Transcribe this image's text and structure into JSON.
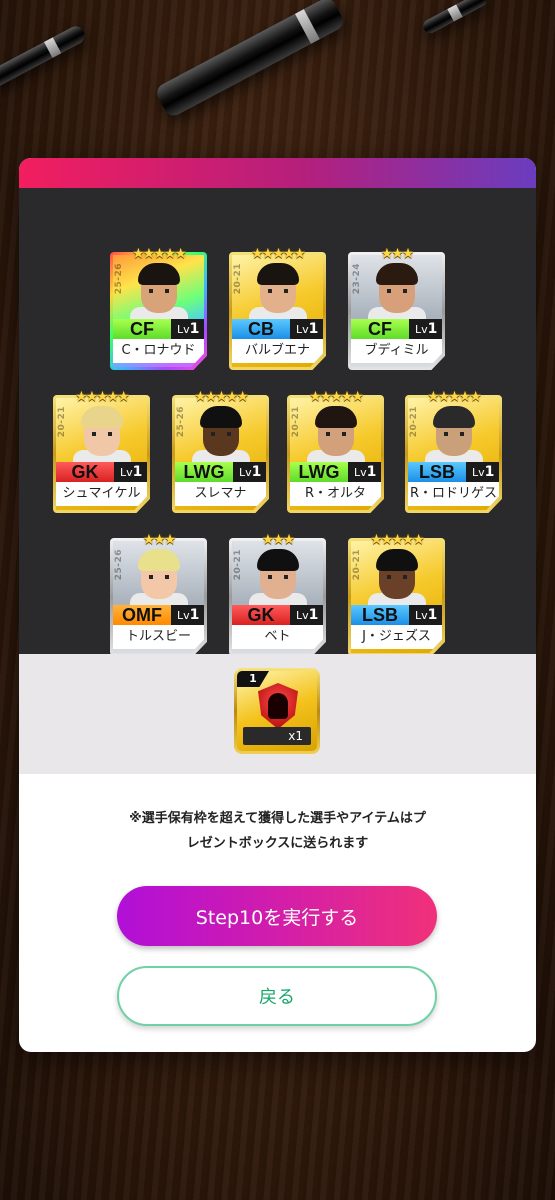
{
  "cards": [
    {
      "stars": "★★★★★",
      "season": "25-26",
      "position": "CF",
      "level_prefix": "Lv",
      "level": "1",
      "name": "C・ロナウド",
      "rarity": "rainbow",
      "pos_group": "fw"
    },
    {
      "stars": "★★★★★",
      "season": "20-21",
      "position": "CB",
      "level_prefix": "Lv",
      "level": "1",
      "name": "バルブエナ",
      "rarity": "gold",
      "pos_group": "df"
    },
    {
      "stars": "★★★",
      "season": "23-24",
      "position": "CF",
      "level_prefix": "Lv",
      "level": "1",
      "name": "ブディミル",
      "rarity": "silver",
      "pos_group": "fw"
    },
    {
      "stars": "★★★★★",
      "season": "20-21",
      "position": "GK",
      "level_prefix": "Lv",
      "level": "1",
      "name": "シュマイケル",
      "rarity": "gold",
      "pos_group": "gk"
    },
    {
      "stars": "★★★★★",
      "season": "25-26",
      "position": "LWG",
      "level_prefix": "Lv",
      "level": "1",
      "name": "スレマナ",
      "rarity": "gold",
      "pos_group": "fw"
    },
    {
      "stars": "★★★★★",
      "season": "20-21",
      "position": "LWG",
      "level_prefix": "Lv",
      "level": "1",
      "name": "R・オルタ",
      "rarity": "gold",
      "pos_group": "fw"
    },
    {
      "stars": "★★★★★",
      "season": "20-21",
      "position": "LSB",
      "level_prefix": "Lv",
      "level": "1",
      "name": "R・ロドリゲス",
      "rarity": "gold",
      "pos_group": "df"
    },
    {
      "stars": "★★★",
      "season": "25-26",
      "position": "OMF",
      "level_prefix": "Lv",
      "level": "1",
      "name": "トルスビー",
      "rarity": "silver",
      "pos_group": "mf"
    },
    {
      "stars": "★★★",
      "season": "20-21",
      "position": "GK",
      "level_prefix": "Lv",
      "level": "1",
      "name": "ベト",
      "rarity": "silver",
      "pos_group": "gk"
    },
    {
      "stars": "★★★★★",
      "season": "20-21",
      "position": "LSB",
      "level_prefix": "Lv",
      "level": "1",
      "name": "J・ジェズス",
      "rarity": "gold",
      "pos_group": "df"
    }
  ],
  "item": {
    "number": "1",
    "count": "x1",
    "icon": "red-shield-player-silhouette-icon"
  },
  "notice": {
    "line1": "※選手保有枠を超えて獲得した選手やアイテムはプ",
    "line2": "レゼントボックスに送られます"
  },
  "buttons": {
    "execute": "Step10を実行する",
    "back": "戻る"
  },
  "colors": {
    "header_start": "#f21e5f",
    "header_end": "#6a3dbf",
    "primary_start": "#b10fd8",
    "primary_end": "#f03179",
    "back_text": "#17a56a",
    "back_border": "#6fd1a5"
  }
}
